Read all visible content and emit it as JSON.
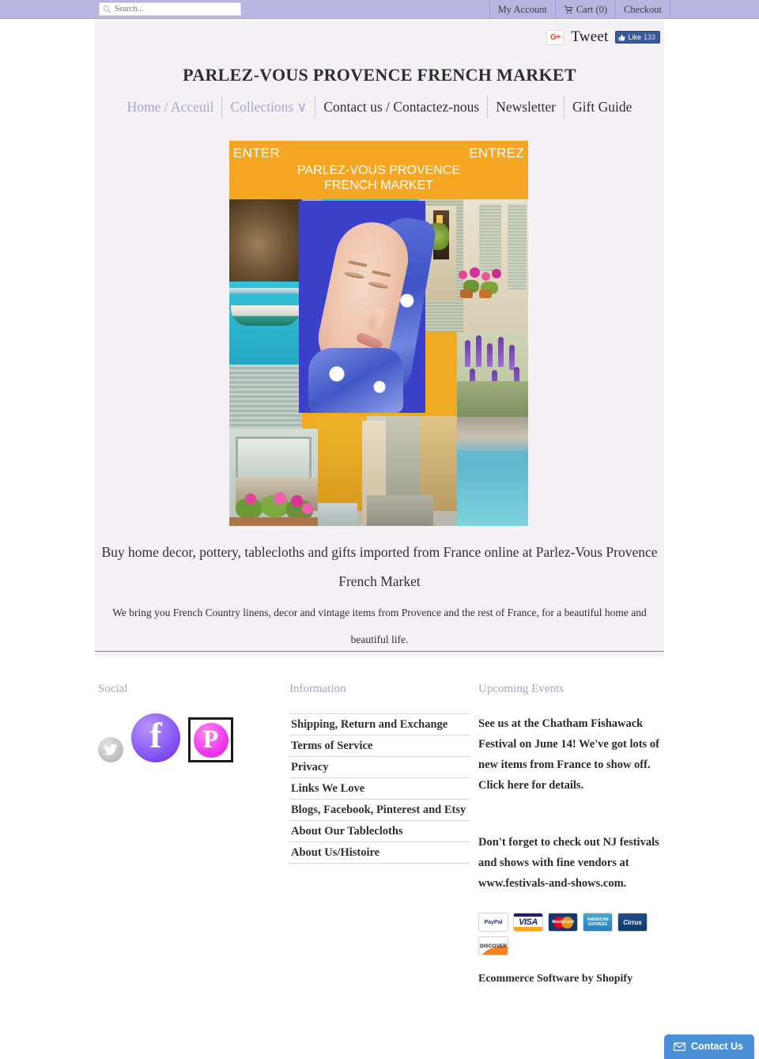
{
  "topbar": {
    "search": {
      "placeholder": "Search...",
      "value": "",
      "icon": "search-icon"
    },
    "links": [
      {
        "label": "My Account",
        "icon": null
      },
      {
        "label": "Cart (0)",
        "icon": "cart-icon"
      },
      {
        "label": "Checkout",
        "icon": null
      }
    ]
  },
  "share": {
    "gplus_label": "G+",
    "tweet_label": "Tweet",
    "like_label": "Like",
    "like_count": "133"
  },
  "header": {
    "title": "PARLEZ-VOUS PROVENCE FRENCH MARKET",
    "nav": [
      {
        "label": "Home / Acceuil",
        "style": "muted"
      },
      {
        "label": "Collections ∨",
        "style": "muted"
      },
      {
        "label": "Contact us / Contactez-nous",
        "style": "dark"
      },
      {
        "label": "Newsletter",
        "style": "dark"
      },
      {
        "label": "Gift Guide",
        "style": "dark"
      }
    ]
  },
  "hero": {
    "enter_left": "ENTER",
    "enter_right": "ENTREZ",
    "brand_line1": "PARLEZ-VOUS PROVENCE",
    "brand_line2": "FRENCH MARKET",
    "banner_color": "#f5a623"
  },
  "main": {
    "tagline": "Buy home decor, pottery, tablecloths and gifts imported from France online at Parlez-Vous Provence French Market",
    "subline": "We bring you French Country linens, decor and vintage items from Provence and the rest of France, for a beautiful home and beautiful life."
  },
  "footer": {
    "social": {
      "heading": "Social",
      "icons": [
        {
          "name": "twitter-icon",
          "label": "Twitter"
        },
        {
          "name": "facebook-icon",
          "label": "f"
        },
        {
          "name": "pinterest-icon",
          "label": "P"
        }
      ]
    },
    "information": {
      "heading": "Information",
      "links": [
        "Shipping, Return and Exchange",
        "Terms of Service",
        "Privacy",
        "Links We Love",
        "Blogs, Facebook, Pinterest and Etsy",
        "About Our Tablecloths",
        "About Us/Histoire"
      ]
    },
    "events": {
      "heading": "Upcoming Events",
      "paragraph1": "See us at the Chatham Fishawack Festival on June 14!  We've got lots of new items from France to show off.  Click here for details.",
      "paragraph2": "Don't forget to check out NJ festivals and shows with fine vendors at www.festivals-and-shows.com.",
      "payments": [
        "PayPal",
        "VISA",
        "MasterCard",
        "AMERICAN EXPRESS",
        "Cirrus",
        "DISCOVER"
      ],
      "credit": "Ecommerce Software by Shopify"
    }
  },
  "contact_widget": {
    "label": "Contact Us",
    "icon": "envelope-icon",
    "color": "#4a90d9"
  },
  "colors": {
    "topbar": "#b9b5e0",
    "page_bg": "#f3f1f4",
    "accent_purple": "#a8a3cf",
    "hero_orange": "#f5a623",
    "facebook_blue": "#3b5998"
  }
}
